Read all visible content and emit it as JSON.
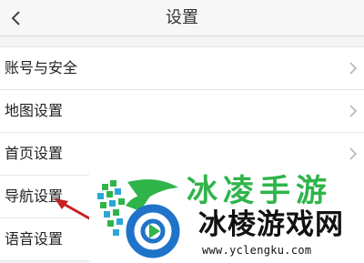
{
  "navbar": {
    "title": "设置",
    "back_icon": "chevron-left-icon"
  },
  "settings": {
    "items": [
      {
        "label": "账号与安全",
        "icon": "chevron-right-icon"
      },
      {
        "label": "地图设置",
        "icon": "chevron-right-icon"
      },
      {
        "label": "首页设置",
        "icon": "chevron-right-icon"
      },
      {
        "label": "导航设置",
        "icon": "chevron-right-icon"
      },
      {
        "label": "语音设置",
        "icon": "chevron-right-icon"
      }
    ]
  },
  "annotation": {
    "arrow_color": "#c8201e",
    "points_to": "导航设置"
  },
  "watermark": {
    "top_text": "冰凌手游",
    "main_text": "冰棱游戏网",
    "url": "www.yclengku.com",
    "accent_color": "#2fb44a"
  }
}
